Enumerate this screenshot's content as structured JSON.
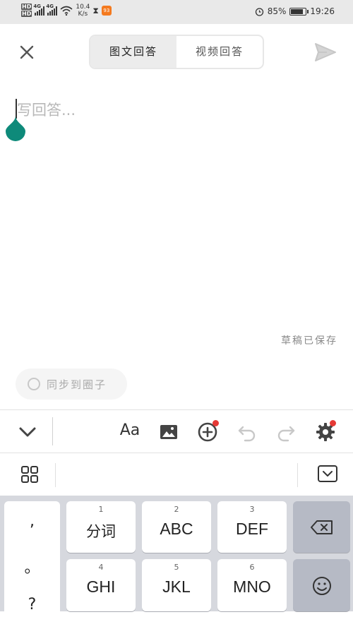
{
  "status_bar": {
    "hd1": "HD",
    "hd2": "HD",
    "net1": "4G",
    "net2": "4G",
    "speed_value": "10.4",
    "speed_unit": "K/s",
    "app_badge": "93",
    "battery_percent": "85%",
    "battery_level": 0.85,
    "time": "19:26"
  },
  "header": {
    "tabs": [
      {
        "label": "图文回答",
        "active": true
      },
      {
        "label": "视频回答",
        "active": false
      }
    ]
  },
  "editor": {
    "placeholder": "写回答...",
    "draft_status": "草稿已保存",
    "sync_label": "同步到圈子",
    "accent_color": "#0e8a7a"
  },
  "toolbar": {
    "font_label": "Aa",
    "badge_color": "#e53935"
  },
  "keyboard": {
    "punctuation": [
      ",",
      "。",
      "?"
    ],
    "keys_row1": [
      {
        "num": "1",
        "label": "分词"
      },
      {
        "num": "2",
        "label": "ABC"
      },
      {
        "num": "3",
        "label": "DEF"
      }
    ],
    "keys_row2": [
      {
        "num": "4",
        "label": "GHI"
      },
      {
        "num": "5",
        "label": "JKL"
      },
      {
        "num": "6",
        "label": "MNO"
      }
    ]
  }
}
